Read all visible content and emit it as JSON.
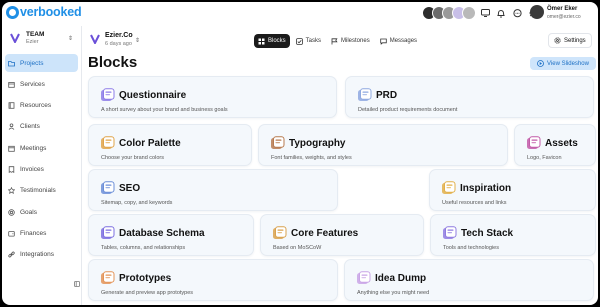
{
  "app": {
    "logo_text": "verbooked"
  },
  "user": {
    "name": "Ömer Eker",
    "email": "omer@ezier.co"
  },
  "team": {
    "name": "TEAM",
    "sub": "Ezier"
  },
  "project": {
    "name": "Ezier.Co",
    "sub": "6 days ago"
  },
  "sidebar": {
    "items": [
      {
        "label": "Projects",
        "icon": "folder-icon",
        "active": true
      },
      {
        "label": "Services",
        "icon": "box-icon"
      },
      {
        "label": "Resources",
        "icon": "book-icon"
      },
      {
        "label": "Clients",
        "icon": "user-icon"
      },
      {
        "label": "Meetings",
        "icon": "calendar-icon"
      },
      {
        "label": "Invoices",
        "icon": "receipt-icon"
      },
      {
        "label": "Testimonials",
        "icon": "star-icon"
      },
      {
        "label": "Goals",
        "icon": "target-icon"
      },
      {
        "label": "Finances",
        "icon": "wallet-icon"
      },
      {
        "label": "Integrations",
        "icon": "link-icon"
      }
    ]
  },
  "tabs": [
    {
      "label": "Blocks",
      "icon": "grid-icon",
      "active": true
    },
    {
      "label": "Tasks",
      "icon": "check-icon"
    },
    {
      "label": "Milestones",
      "icon": "flag-icon"
    },
    {
      "label": "Messages",
      "icon": "chat-icon"
    }
  ],
  "settings_label": "Settings",
  "page": {
    "title": "Blocks",
    "view_button": "View Slideshow"
  },
  "blocks": [
    {
      "title": "Questionnaire",
      "desc": "A short survey about your brand and business goals",
      "icon": "questionnaire-icon",
      "color": "#8d7ce8"
    },
    {
      "title": "PRD",
      "desc": "Detailed product requirements document",
      "icon": "document-icon",
      "color": "#8ea8e0"
    },
    {
      "title": "Color Palette",
      "desc": "Choose your brand colors",
      "icon": "palette-icon",
      "color": "#e0a44a"
    },
    {
      "title": "Typography",
      "desc": "Font families, weights, and styles",
      "icon": "typography-icon",
      "color": "#b77a4f"
    },
    {
      "title": "Assets",
      "desc": "Logo, Favicon",
      "icon": "assets-icon",
      "color": "#c25aa8"
    },
    {
      "title": "SEO",
      "desc": "Sitemap, copy, and keywords",
      "icon": "seo-icon",
      "color": "#6c8fd8"
    },
    {
      "title": "Inspiration",
      "desc": "Useful resources and links",
      "icon": "inspiration-icon",
      "color": "#e2b04a"
    },
    {
      "title": "Database Schema",
      "desc": "Tables, columns, and relationships",
      "icon": "database-icon",
      "color": "#7d6fe0"
    },
    {
      "title": "Core Features",
      "desc": "Based on MoSCoW",
      "icon": "features-icon",
      "color": "#d9a24e"
    },
    {
      "title": "Tech Stack",
      "desc": "Tools and technologies",
      "icon": "techstack-icon",
      "color": "#8f7be0"
    },
    {
      "title": "Prototypes",
      "desc": "Generate and preview app prototypes",
      "icon": "prototype-icon",
      "color": "#e39458"
    },
    {
      "title": "Idea Dump",
      "desc": "Anything else you might need",
      "icon": "idea-icon",
      "color": "#c9a4e6"
    }
  ]
}
